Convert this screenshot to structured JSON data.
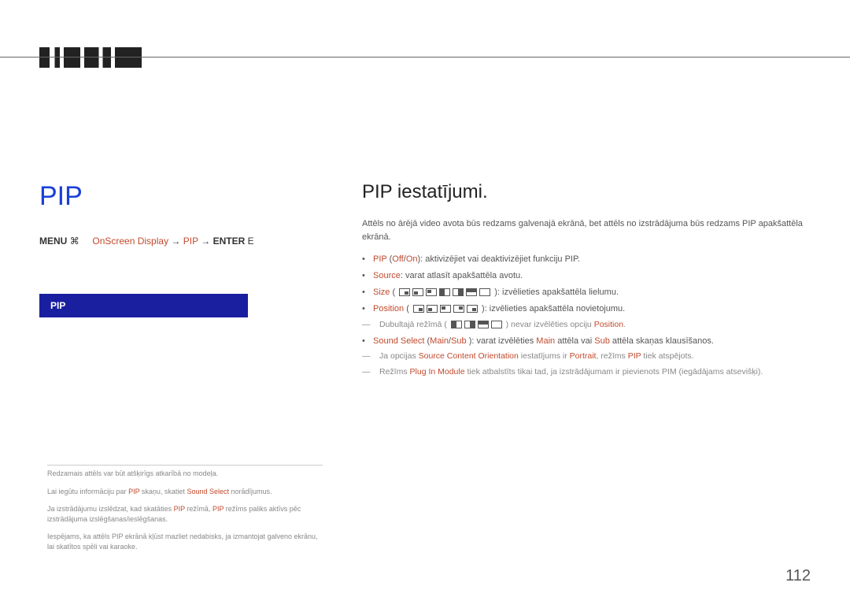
{
  "page_number": "112",
  "left": {
    "title": "PIP",
    "breadcrumb": {
      "menu": "MENU",
      "menu_icon": "⌘",
      "path1": "OnScreen Display",
      "arrow": "→",
      "path2": "PIP",
      "enter": "ENTER",
      "enter_icon": "E"
    },
    "pip_bar": "PIP"
  },
  "footnotes": {
    "n1": "Redzamais attēls var būt atšķirīgs atkarībā no modeļa.",
    "n2_a": "Lai iegūtu informāciju par ",
    "n2_b": "PIP",
    "n2_c": " skaņu, skatiet ",
    "n2_d": "Sound Select",
    "n2_e": " norādījumus.",
    "n3_a": "Ja izstrādājumu izslēdzat, kad skatāties ",
    "n3_b": "PIP",
    "n3_c": " režīmā, ",
    "n3_d": "PIP",
    "n3_e": " režīms paliks aktīvs pēc izstrādājuma izslēgšanas/ieslēgšanas.",
    "n4": "Iespējams, ka attēls PIP ekrānā kļūst mazliet nedabisks, ja izmantojat galveno ekrānu, lai skatītos spēli vai karaoke."
  },
  "right": {
    "title": "PIP iestatījumi.",
    "intro": "Attēls no ārējā video avota būs redzams galvenajā ekrānā, bet attēls no izstrādājuma būs redzams PIP apakšattēla ekrānā.",
    "b1_a": "PIP",
    "b1_b": " (",
    "b1_c": "Off",
    "b1_d": "/",
    "b1_e": "On",
    "b1_f": "): aktivizējiet vai deaktivizējiet funkciju PIP.",
    "b2_a": "Source",
    "b2_b": ": varat atlasīt apakšattēla avotu.",
    "b3_a": "Size",
    "b3_b": " (",
    "b3_c": "): izvēlieties apakšattēla lielumu.",
    "b4_a": "Position",
    "b4_b": " (",
    "b4_c": "): izvēlieties apakšattēla novietojumu.",
    "b4_note_a": "Dubultajā režīmā (",
    "b4_note_b": ") nevar izvēlēties opciju ",
    "b4_note_c": "Position",
    "b4_note_d": ".",
    "b5_a": "Sound Select",
    "b5_b": " (",
    "b5_c": "Main",
    "b5_d": "/",
    "b5_e": "Sub",
    "b5_f": " ): varat izvēlēties ",
    "b5_g": "Main",
    "b5_h": " attēla vai ",
    "b5_i": "Sub",
    "b5_j": " attēla skaņas klausīšanos.",
    "d1_a": "Ja opcijas ",
    "d1_b": "Source Content Orientation",
    "d1_c": " iestatījums ir ",
    "d1_d": "Portrait",
    "d1_e": ", režīms ",
    "d1_f": "PIP",
    "d1_g": " tiek atspējots.",
    "d2_a": "Režīms ",
    "d2_b": "Plug In Module",
    "d2_c": " tiek atbalstīts tikai tad, ja izstrādājumam ir pievienots PIM (iegādājams atsevišķi)."
  }
}
